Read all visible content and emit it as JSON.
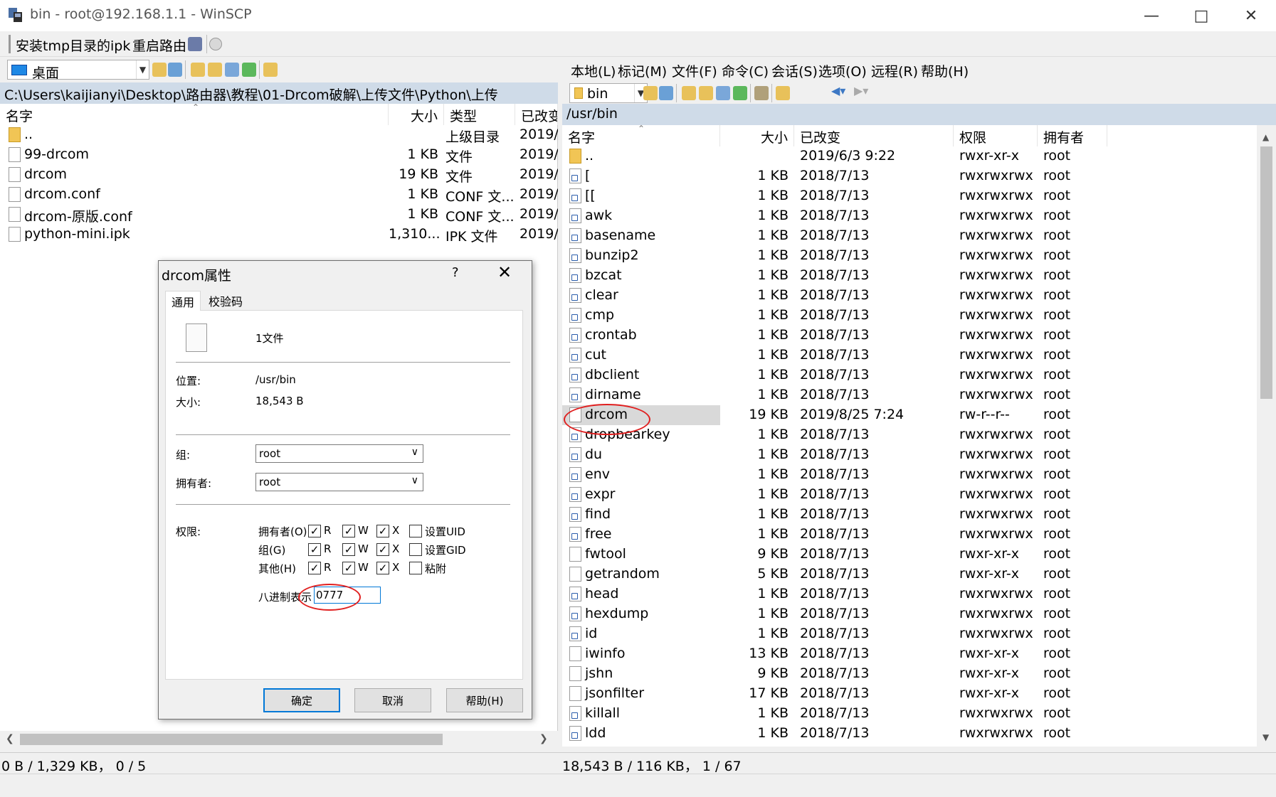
{
  "window": {
    "title": "bin - root@192.168.1.1 - WinSCP"
  },
  "toolbar1": {
    "item1": "安装tmp目录的ipk",
    "item2": "重启路由"
  },
  "local": {
    "drive": "桌面",
    "path": "C:\\Users\\kaijianyi\\Desktop\\路由器\\教程\\01-Drcom破解\\上传文件\\Python\\上传",
    "columns": [
      "名字",
      "大小",
      "类型",
      "已改变"
    ],
    "files": [
      {
        "name": "..",
        "size": "",
        "type": "上级目录",
        "changed": "2019/"
      },
      {
        "name": "99-drcom",
        "size": "1 KB",
        "type": "文件",
        "changed": "2019/"
      },
      {
        "name": "drcom",
        "size": "19 KB",
        "type": "文件",
        "changed": "2019/"
      },
      {
        "name": "drcom.conf",
        "size": "1 KB",
        "type": "CONF 文...",
        "changed": "2019/"
      },
      {
        "name": "drcom-原版.conf",
        "size": "1 KB",
        "type": "CONF 文...",
        "changed": "2019/"
      },
      {
        "name": "python-mini.ipk",
        "size": "1,310...",
        "type": "IPK 文件",
        "changed": "2019/"
      }
    ],
    "status": "0 B / 1,329 KB，  0 / 5"
  },
  "menu": [
    "本地(L)",
    "标记(M)",
    "文件(F)",
    "命令(C)",
    "会话(S)",
    "选项(O)",
    "远程(R)",
    "帮助(H)"
  ],
  "remote": {
    "dir": "bin",
    "path": "/usr/bin",
    "columns": [
      "名字",
      "大小",
      "已改变",
      "权限",
      "拥有者"
    ],
    "files": [
      {
        "name": "..",
        "size": "",
        "changed": "2019/6/3 9:22",
        "rights": "rwxr-xr-x",
        "owner": "root",
        "icon": "up"
      },
      {
        "name": "[",
        "size": "1 KB",
        "changed": "2018/7/13",
        "rights": "rwxrwxrwx",
        "owner": "root",
        "icon": "link"
      },
      {
        "name": "[[",
        "size": "1 KB",
        "changed": "2018/7/13",
        "rights": "rwxrwxrwx",
        "owner": "root",
        "icon": "link"
      },
      {
        "name": "awk",
        "size": "1 KB",
        "changed": "2018/7/13",
        "rights": "rwxrwxrwx",
        "owner": "root",
        "icon": "link"
      },
      {
        "name": "basename",
        "size": "1 KB",
        "changed": "2018/7/13",
        "rights": "rwxrwxrwx",
        "owner": "root",
        "icon": "link"
      },
      {
        "name": "bunzip2",
        "size": "1 KB",
        "changed": "2018/7/13",
        "rights": "rwxrwxrwx",
        "owner": "root",
        "icon": "link"
      },
      {
        "name": "bzcat",
        "size": "1 KB",
        "changed": "2018/7/13",
        "rights": "rwxrwxrwx",
        "owner": "root",
        "icon": "link"
      },
      {
        "name": "clear",
        "size": "1 KB",
        "changed": "2018/7/13",
        "rights": "rwxrwxrwx",
        "owner": "root",
        "icon": "link"
      },
      {
        "name": "cmp",
        "size": "1 KB",
        "changed": "2018/7/13",
        "rights": "rwxrwxrwx",
        "owner": "root",
        "icon": "link"
      },
      {
        "name": "crontab",
        "size": "1 KB",
        "changed": "2018/7/13",
        "rights": "rwxrwxrwx",
        "owner": "root",
        "icon": "link"
      },
      {
        "name": "cut",
        "size": "1 KB",
        "changed": "2018/7/13",
        "rights": "rwxrwxrwx",
        "owner": "root",
        "icon": "link"
      },
      {
        "name": "dbclient",
        "size": "1 KB",
        "changed": "2018/7/13",
        "rights": "rwxrwxrwx",
        "owner": "root",
        "icon": "link"
      },
      {
        "name": "dirname",
        "size": "1 KB",
        "changed": "2018/7/13",
        "rights": "rwxrwxrwx",
        "owner": "root",
        "icon": "link"
      },
      {
        "name": "drcom",
        "size": "19 KB",
        "changed": "2019/8/25 7:24",
        "rights": "rw-r--r--",
        "owner": "root",
        "icon": "file"
      },
      {
        "name": "dropbearkey",
        "size": "1 KB",
        "changed": "2018/7/13",
        "rights": "rwxrwxrwx",
        "owner": "root",
        "icon": "link"
      },
      {
        "name": "du",
        "size": "1 KB",
        "changed": "2018/7/13",
        "rights": "rwxrwxrwx",
        "owner": "root",
        "icon": "link"
      },
      {
        "name": "env",
        "size": "1 KB",
        "changed": "2018/7/13",
        "rights": "rwxrwxrwx",
        "owner": "root",
        "icon": "link"
      },
      {
        "name": "expr",
        "size": "1 KB",
        "changed": "2018/7/13",
        "rights": "rwxrwxrwx",
        "owner": "root",
        "icon": "link"
      },
      {
        "name": "find",
        "size": "1 KB",
        "changed": "2018/7/13",
        "rights": "rwxrwxrwx",
        "owner": "root",
        "icon": "link"
      },
      {
        "name": "free",
        "size": "1 KB",
        "changed": "2018/7/13",
        "rights": "rwxrwxrwx",
        "owner": "root",
        "icon": "link"
      },
      {
        "name": "fwtool",
        "size": "9 KB",
        "changed": "2018/7/13",
        "rights": "rwxr-xr-x",
        "owner": "root",
        "icon": "file"
      },
      {
        "name": "getrandom",
        "size": "5 KB",
        "changed": "2018/7/13",
        "rights": "rwxr-xr-x",
        "owner": "root",
        "icon": "file"
      },
      {
        "name": "head",
        "size": "1 KB",
        "changed": "2018/7/13",
        "rights": "rwxrwxrwx",
        "owner": "root",
        "icon": "link"
      },
      {
        "name": "hexdump",
        "size": "1 KB",
        "changed": "2018/7/13",
        "rights": "rwxrwxrwx",
        "owner": "root",
        "icon": "link"
      },
      {
        "name": "id",
        "size": "1 KB",
        "changed": "2018/7/13",
        "rights": "rwxrwxrwx",
        "owner": "root",
        "icon": "link"
      },
      {
        "name": "iwinfo",
        "size": "13 KB",
        "changed": "2018/7/13",
        "rights": "rwxr-xr-x",
        "owner": "root",
        "icon": "file"
      },
      {
        "name": "jshn",
        "size": "9 KB",
        "changed": "2018/7/13",
        "rights": "rwxr-xr-x",
        "owner": "root",
        "icon": "file"
      },
      {
        "name": "jsonfilter",
        "size": "17 KB",
        "changed": "2018/7/13",
        "rights": "rwxr-xr-x",
        "owner": "root",
        "icon": "file"
      },
      {
        "name": "killall",
        "size": "1 KB",
        "changed": "2018/7/13",
        "rights": "rwxrwxrwx",
        "owner": "root",
        "icon": "link"
      },
      {
        "name": "ldd",
        "size": "1 KB",
        "changed": "2018/7/13",
        "rights": "rwxrwxrwx",
        "owner": "root",
        "icon": "link"
      }
    ],
    "status": "18,543 B / 116 KB，  1 / 67"
  },
  "dialog": {
    "title": "drcom属性",
    "help_q": "?",
    "tabs": [
      "通用",
      "校验码"
    ],
    "file_count": "1文件",
    "location_label": "位置:",
    "location_value": "/usr/bin",
    "size_label": "大小:",
    "size_value": "18,543 B",
    "group_label": "组:",
    "group_value": "root",
    "owner_label": "拥有者:",
    "owner_value": "root",
    "perm_label": "权限:",
    "rows": [
      {
        "label": "拥有者(O)",
        "r": "R",
        "w": "W",
        "x": "X",
        "extra": "设置UID"
      },
      {
        "label": "组(G)",
        "r": "R",
        "w": "W",
        "x": "X",
        "extra": "设置GID"
      },
      {
        "label": "其他(H)",
        "r": "R",
        "w": "W",
        "x": "X",
        "extra": "粘附"
      }
    ],
    "octal_label": "八进制表示",
    "octal_value": "0777",
    "ok": "确定",
    "cancel": "取消",
    "help": "帮助(H)"
  },
  "colors": {
    "path_bar": "#cfdbe8",
    "highlight": "#e02020",
    "accent": "#0078d7"
  }
}
